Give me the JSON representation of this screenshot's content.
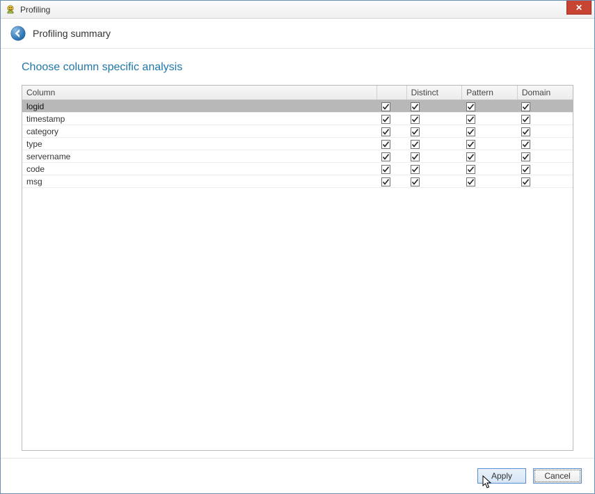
{
  "window": {
    "title": "Profiling"
  },
  "subheader": {
    "title": "Profiling summary"
  },
  "section": {
    "heading": "Choose column specific analysis"
  },
  "table": {
    "headers": {
      "column": "Column",
      "check1": "",
      "distinct": "Distinct",
      "pattern": "Pattern",
      "domain": "Domain"
    },
    "rows": [
      {
        "name": "logid",
        "selected": true,
        "c1": true,
        "distinct": true,
        "pattern": true,
        "domain": true
      },
      {
        "name": "timestamp",
        "selected": false,
        "c1": true,
        "distinct": true,
        "pattern": true,
        "domain": true
      },
      {
        "name": "category",
        "selected": false,
        "c1": true,
        "distinct": true,
        "pattern": true,
        "domain": true
      },
      {
        "name": "type",
        "selected": false,
        "c1": true,
        "distinct": true,
        "pattern": true,
        "domain": true
      },
      {
        "name": "servername",
        "selected": false,
        "c1": true,
        "distinct": true,
        "pattern": true,
        "domain": true
      },
      {
        "name": "code",
        "selected": false,
        "c1": true,
        "distinct": true,
        "pattern": true,
        "domain": true
      },
      {
        "name": "msg",
        "selected": false,
        "c1": true,
        "distinct": true,
        "pattern": true,
        "domain": true
      }
    ]
  },
  "buttons": {
    "apply": "Apply",
    "cancel": "Cancel"
  }
}
